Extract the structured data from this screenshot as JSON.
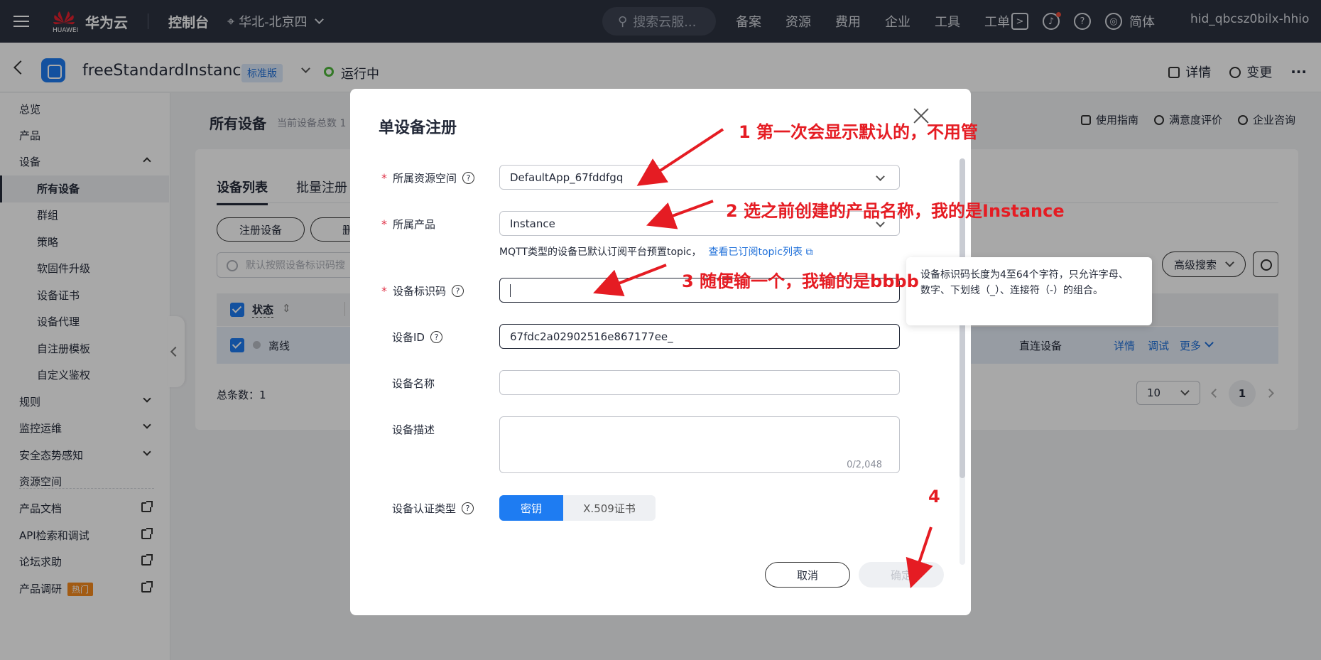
{
  "topbar": {
    "brand": "华为云",
    "brand_sub": "HUAWEI",
    "console": "控制台",
    "region": "华北-北京四",
    "search_placeholder": "搜索云服...",
    "nav": [
      "备案",
      "资源",
      "费用",
      "企业",
      "工具",
      "工单"
    ],
    "lang": "简体",
    "user": "hid_qbcsz0bilx-hhio"
  },
  "header": {
    "instance_name": "freeStandardInstance",
    "edition": "标准版",
    "status": "运行中",
    "details": "详情",
    "change": "变更",
    "more": "···"
  },
  "sidebar": {
    "items": [
      {
        "label": "总览"
      },
      {
        "label": "产品"
      },
      {
        "label": "设备"
      },
      {
        "label": "所有设备"
      },
      {
        "label": "群组"
      },
      {
        "label": "策略"
      },
      {
        "label": "软固件升级"
      },
      {
        "label": "设备证书"
      },
      {
        "label": "设备代理"
      },
      {
        "label": "自注册模板"
      },
      {
        "label": "自定义鉴权"
      },
      {
        "label": "规则"
      },
      {
        "label": "监控运维"
      },
      {
        "label": "安全态势感知"
      },
      {
        "label": "资源空间"
      },
      {
        "label": "产品文档"
      },
      {
        "label": "API检索和调试"
      },
      {
        "label": "论坛求助"
      },
      {
        "label": "产品调研"
      }
    ],
    "hot_badge": "热门"
  },
  "main": {
    "title": "所有设备",
    "subtitle": "当前设备总数 1",
    "actions": [
      "使用指南",
      "满意度评价",
      "企业咨询"
    ],
    "tabs": [
      "设备列表",
      "批量注册"
    ],
    "register_button": "注册设备",
    "second_button": "删",
    "search_placeholder": "默认按照设备标识码搜",
    "advanced_search": "高级搜索",
    "table": {
      "header_status": "状态",
      "row_status": "离线",
      "row_node_type": "直连设备",
      "row_actions": [
        "详情",
        "调试",
        "更多"
      ]
    },
    "total": "总条数：1",
    "page_size": "10",
    "current_page": "1"
  },
  "modal": {
    "title": "单设备注册",
    "fields": {
      "resource_space": {
        "label": "所属资源空间",
        "value": "DefaultApp_67fddfgq"
      },
      "product": {
        "label": "所属产品",
        "value": "Instance"
      },
      "hint_text": "MQTT类型的设备已默认订阅平台预置topic，",
      "hint_link": "查看已订阅topic列表",
      "node_id": {
        "label": "设备标识码",
        "value": ""
      },
      "device_id": {
        "label": "设备ID",
        "value": "67fdc2a02902516e867177ee_"
      },
      "device_name": {
        "label": "设备名称",
        "value": ""
      },
      "description": {
        "label": "设备描述",
        "counter": "0/2,048"
      },
      "auth_type": {
        "label": "设备认证类型",
        "options": [
          "密钥",
          "X.509证书"
        ],
        "selected": "密钥"
      }
    },
    "cancel": "取消",
    "confirm": "确定",
    "tooltip": "设备标识码长度为4至64个字符，只允许字母、数字、下划线（_）、连接符（-）的组合。"
  },
  "annotations": [
    "1 第一次会显示默认的，不用管",
    "2 选之前创建的产品名称，我的是Instance",
    "3 随便输一个，我输的是bbbb",
    "4"
  ],
  "colors": {
    "topbar": "#2d3340",
    "primary": "#1e7cf2",
    "annotation": "#e51c23",
    "status_running": "#50b83c"
  }
}
